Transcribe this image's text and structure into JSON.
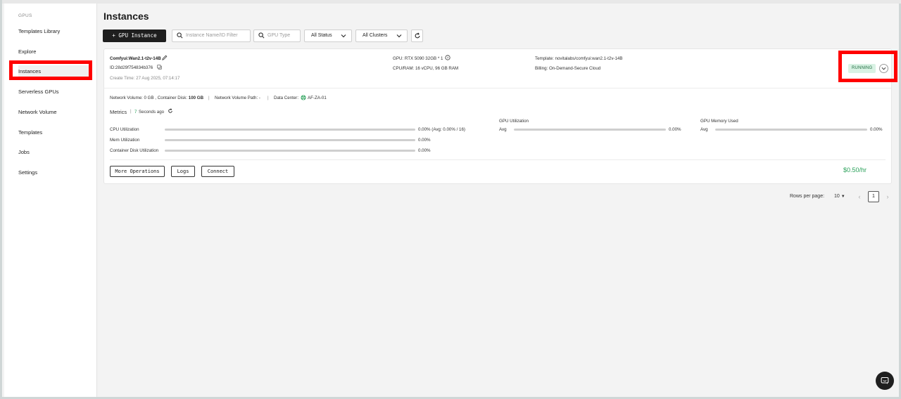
{
  "sidebar": {
    "section_label": "GPUS",
    "items": [
      {
        "label": "Templates Library"
      },
      {
        "label": "Explore"
      },
      {
        "label": "Instances"
      },
      {
        "label": "Serverless GPUs"
      },
      {
        "label": "Network Volume"
      },
      {
        "label": "Templates"
      },
      {
        "label": "Jobs"
      },
      {
        "label": "Settings"
      }
    ],
    "active_item": "Instances"
  },
  "header": {
    "title": "Instances"
  },
  "toolbar": {
    "add_button_label": "+ GPU Instance",
    "name_filter_placeholder": "Instance Name/ID Filter",
    "gpu_type_placeholder": "GPU Type",
    "status_select_value": "All Status",
    "cluster_select_value": "All Clusters"
  },
  "instance": {
    "name": "Comfyui:Wan2.1-t2v-14B",
    "id_text": "ID:28d29f754834b376",
    "create_time": "Create Time: 27 Aug 2025, 07:14:17",
    "gpu": "GPU: RTX 5090 32GB * 1",
    "cpu_ram": "CPU/RAM: 16 vCPU, 96 GB RAM",
    "template": "Template: novitalabs/comfyui:wan2.1-t2v-14B",
    "billing": "Billing: On-Demand-Secure Cloud",
    "status": "RUNNING",
    "network_volume": "Network Volume: 0 GB , Container Disk: ",
    "container_disk": "100 GB",
    "network_volume_path": "Network Volume Path: -",
    "data_center_label": "Data Center:",
    "data_center": "AF-ZA-01",
    "metrics_label": "Metrics",
    "metrics_age_value": "7",
    "metrics_age_unit": "Seconds ago",
    "metrics": {
      "cpu_label": "CPU Utilization",
      "cpu_value": "0.00% (Avg: 0.00% / 16)",
      "mem_label": "Mem Utilization",
      "mem_value": "0.00%",
      "disk_label": "Container Disk Utilization",
      "disk_value": "0.00%",
      "gpu_util_label": "GPU Utilization",
      "gpu_util_avg": "Avg",
      "gpu_util_value": "0.00%",
      "gpu_mem_label": "GPU Memory Used",
      "gpu_mem_avg": "Avg",
      "gpu_mem_value": "0.00%"
    },
    "more_ops_label": "More Operations",
    "logs_label": "Logs",
    "connect_label": "Connect",
    "price": "$0.50/hr"
  },
  "pagination": {
    "rows_per_page_label": "Rows per page:",
    "rows_per_page_value": "10",
    "current_page": "1"
  },
  "colors": {
    "accent_running": "#2aa15a",
    "highlight": "#ff0000",
    "primary_button": "#1e1e1e"
  }
}
